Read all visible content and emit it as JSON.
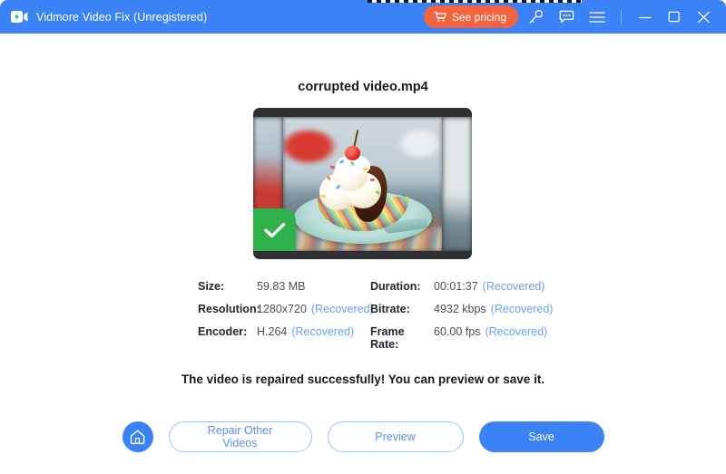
{
  "window": {
    "title": "Vidmore Video Fix (Unregistered)",
    "logo_icon": "video-camera-icon",
    "accent_color": "#3b82f6",
    "pricing_color": "#f4633f",
    "success_color": "#2fb24c"
  },
  "titlebar": {
    "pricing_label": "See pricing",
    "cart_icon": "shopping-cart-icon",
    "key_icon": "key-icon",
    "feedback_icon": "feedback-bubble-icon",
    "menu_icon": "hamburger-menu-icon",
    "minimize_icon": "minimize-icon",
    "maximize_icon": "maximize-icon",
    "close_icon": "close-icon"
  },
  "main": {
    "file_name": "corrupted video.mp4",
    "thumbnail_alt": "ice-cream-sundae-video-frame",
    "success_badge_icon": "check-mark-icon",
    "status_message": "The video is repaired successfully! You can preview or save it."
  },
  "metadata": {
    "rows": [
      {
        "left_label": "Size:",
        "left_value": "59.83 MB",
        "left_tag": "",
        "right_label": "Duration:",
        "right_value": "00:01:37",
        "right_tag": "(Recovered)"
      },
      {
        "left_label": "Resolution:",
        "left_value": "1280x720",
        "left_tag": "(Recovered)",
        "right_label": "Bitrate:",
        "right_value": "4932 kbps",
        "right_tag": "(Recovered)"
      },
      {
        "left_label": "Encoder:",
        "left_value": "H.264",
        "left_tag": "(Recovered)",
        "right_label": "Frame Rate:",
        "right_value": "60.00 fps",
        "right_tag": "(Recovered)"
      }
    ]
  },
  "footer": {
    "home_icon": "home-icon",
    "repair_other_label": "Repair Other Videos",
    "preview_label": "Preview",
    "save_label": "Save"
  }
}
